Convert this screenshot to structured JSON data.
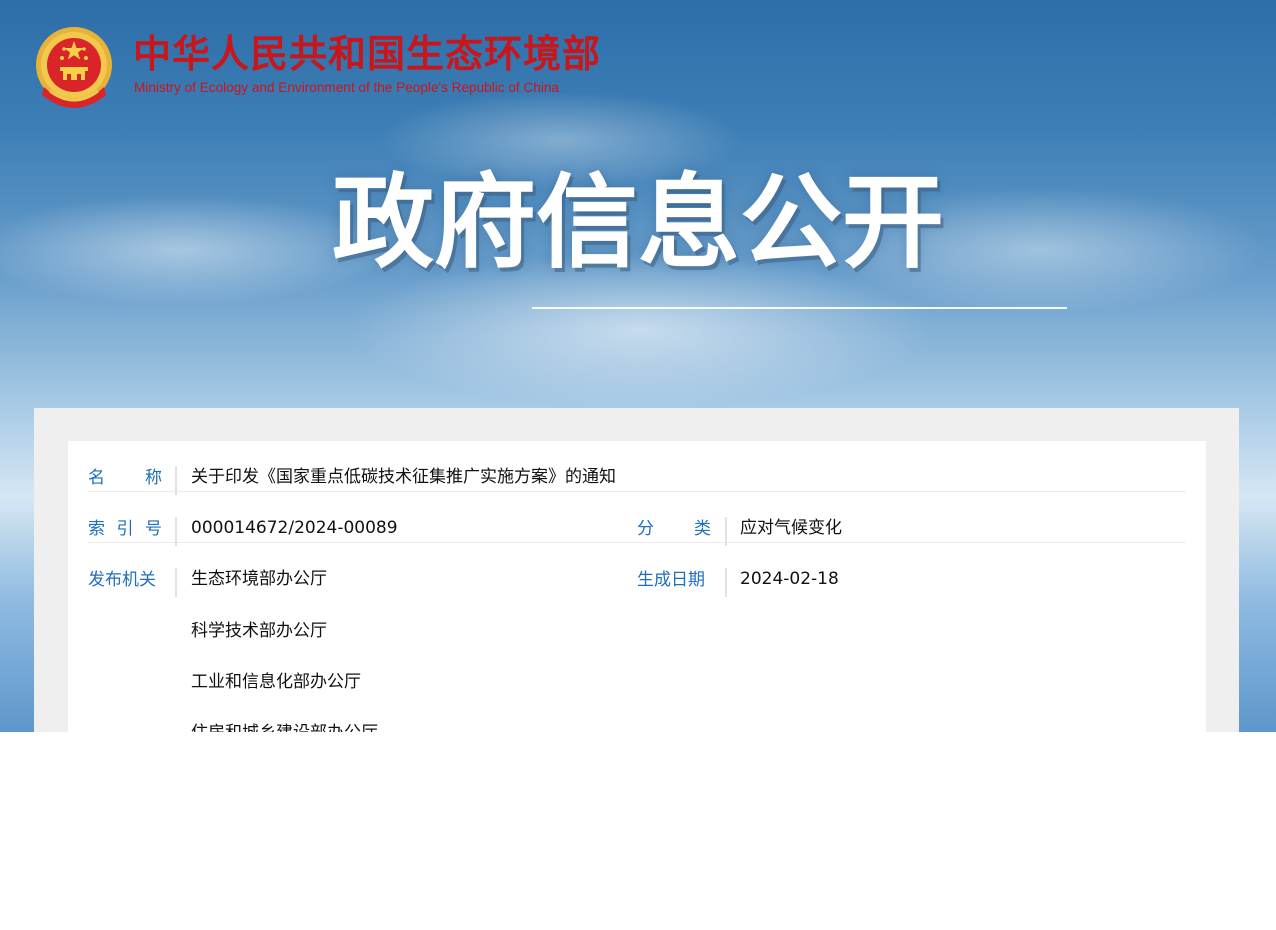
{
  "header": {
    "emblem_icon": "national-emblem-icon",
    "title_cn": "中华人民共和国生态环境部",
    "title_en": "Ministry of Ecology and Environment of the People's Republic of China",
    "brand_color": "#c8161d"
  },
  "hero": {
    "title": "政府信息公开"
  },
  "info": {
    "name": {
      "label": "名称",
      "value": "关于印发《国家重点低碳技术征集推广实施方案》的通知"
    },
    "index": {
      "label": "索引号",
      "value": "000014672/2024-00089"
    },
    "category": {
      "label": "分类",
      "value": "应对气候变化"
    },
    "issuer": {
      "label": "发布机关",
      "values": [
        "生态环境部办公厅",
        "科学技术部办公厅",
        "工业和信息化部办公厅",
        "住房和城乡建设部办公厅"
      ]
    },
    "date": {
      "label": "生成日期",
      "value": "2024-02-18"
    }
  },
  "colors": {
    "label": "#1e6fbd",
    "value": "#111111",
    "panel": "#efefef"
  }
}
